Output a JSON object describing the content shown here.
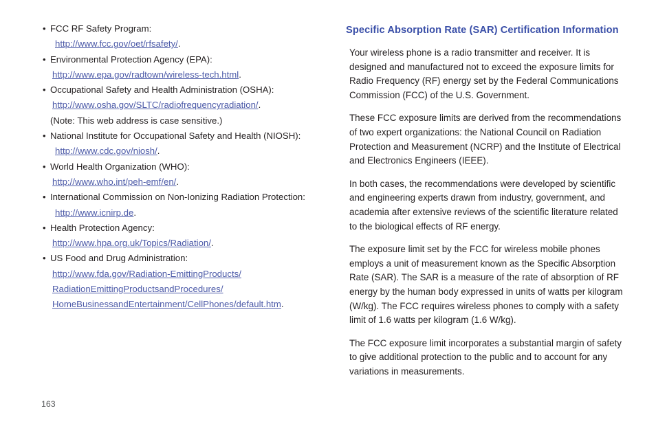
{
  "document": {
    "page_number": "163",
    "colors": {
      "heading_blue": "#3a4fa8",
      "link_blue": "#4c5aa8",
      "body_text": "#231f20",
      "page_number_text": "#58595b",
      "background": "#ffffff"
    }
  },
  "left_column": {
    "bullets": [
      {
        "label": "FCC RF Safety Program:",
        "bullet_glyph": "•",
        "url_lines": [
          "http://www.fcc.gov/oet/rfsafety/"
        ],
        "url_indent": "deep",
        "trailing_period": ".",
        "note": null
      },
      {
        "label": "Environmental Protection Agency (EPA):",
        "bullet_glyph": "•",
        "url_lines": [
          "http://www.epa.gov/radtown/wireless-tech.html"
        ],
        "url_indent": "normal",
        "trailing_period": ".",
        "note": null
      },
      {
        "label": "Occupational Safety and Health Administration (OSHA):",
        "bullet_glyph": "•",
        "url_lines": [
          "http://www.osha.gov/SLTC/radiofrequencyradiation/"
        ],
        "url_indent": "normal",
        "trailing_period": ".",
        "note": "(Note: This web address is case sensitive.)"
      },
      {
        "label": "National Institute for Occupational Safety and Health (NIOSH):",
        "bullet_glyph": "•",
        "url_lines": [
          "http://www.cdc.gov/niosh/"
        ],
        "url_indent": "deep",
        "trailing_period": ".",
        "note": null
      },
      {
        "label": "World Health Organization (WHO):",
        "bullet_glyph": "•",
        "url_lines": [
          "http://www.who.int/peh-emf/en/"
        ],
        "url_indent": "normal",
        "trailing_period": ".",
        "note": null
      },
      {
        "label": "International Commission on Non-Ionizing Radiation Protection:",
        "bullet_glyph": "•",
        "url_lines": [
          "http://www.icnirp.de"
        ],
        "url_indent": "deep",
        "trailing_period": ".",
        "note": null
      },
      {
        "label": "Health Protection Agency:",
        "bullet_glyph": "•",
        "url_lines": [
          "http://www.hpa.org.uk/Topics/Radiation/"
        ],
        "url_indent": "normal",
        "trailing_period": ".",
        "note": null
      },
      {
        "label": "US Food and Drug Administration:",
        "bullet_glyph": "•",
        "url_lines": [
          "http://www.fda.gov/Radiation-EmittingProducts/",
          "RadiationEmittingProductsandProcedures/",
          "HomeBusinessandEntertainment/CellPhones/default.htm"
        ],
        "url_indent": "normal",
        "trailing_period": ".",
        "note": null
      }
    ]
  },
  "right_column": {
    "heading": "Specific Absorption Rate (SAR) Certification Information",
    "paragraphs": [
      "Your wireless phone is a radio transmitter and receiver. It is designed and manufactured not to exceed the exposure limits for Radio Frequency (RF) energy set by the Federal Communications Commission (FCC) of the U.S. Government.",
      "These FCC exposure limits are derived from the recommendations of two expert organizations: the National Council on Radiation Protection and Measurement (NCRP) and the Institute of Electrical and Electronics Engineers (IEEE).",
      "In both cases, the recommendations were developed by scientific and engineering experts drawn from industry, government, and academia after extensive reviews of the scientific literature related to the biological effects of RF energy.",
      "The exposure limit set by the FCC for wireless mobile phones employs a unit of measurement known as the Specific Absorption Rate (SAR). The SAR is a measure of the rate of absorption of RF energy by the human body expressed in units of watts per kilogram (W/kg). The FCC requires wireless phones to comply with a safety limit of 1.6 watts per kilogram (1.6 W/kg).",
      "The FCC exposure limit incorporates a substantial margin of safety to give additional protection to the public and to account for any variations in measurements."
    ]
  }
}
